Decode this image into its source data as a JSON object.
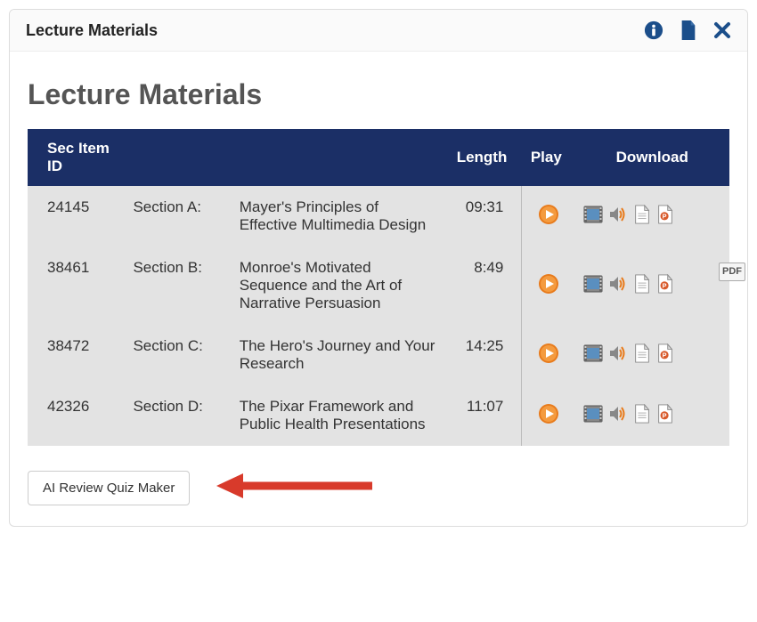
{
  "header": {
    "title": "Lecture Materials"
  },
  "heading": "Lecture Materials",
  "columns": {
    "id": "Sec Item ID",
    "length": "Length",
    "play": "Play",
    "download": "Download"
  },
  "rows": [
    {
      "id": "24145",
      "section": "Section A:",
      "title": "Mayer's Principles of Effective Multimedia Design",
      "length": "09:31"
    },
    {
      "id": "38461",
      "section": "Section B:",
      "title": "Monroe's Motivated Sequence and the Art of Narrative Persuasion",
      "length": "8:49"
    },
    {
      "id": "38472",
      "section": "Section C:",
      "title": "The Hero's Journey and Your Research",
      "length": "14:25"
    },
    {
      "id": "42326",
      "section": "Section D:",
      "title": "The Pixar Framework and Public Health Presentations",
      "length": "11:07"
    }
  ],
  "pdf_label": "PDF",
  "quiz_button": "AI Review Quiz Maker",
  "colors": {
    "header_bg": "#1b2f66",
    "play": "#e87b1c",
    "info": "#1b4e8a"
  }
}
